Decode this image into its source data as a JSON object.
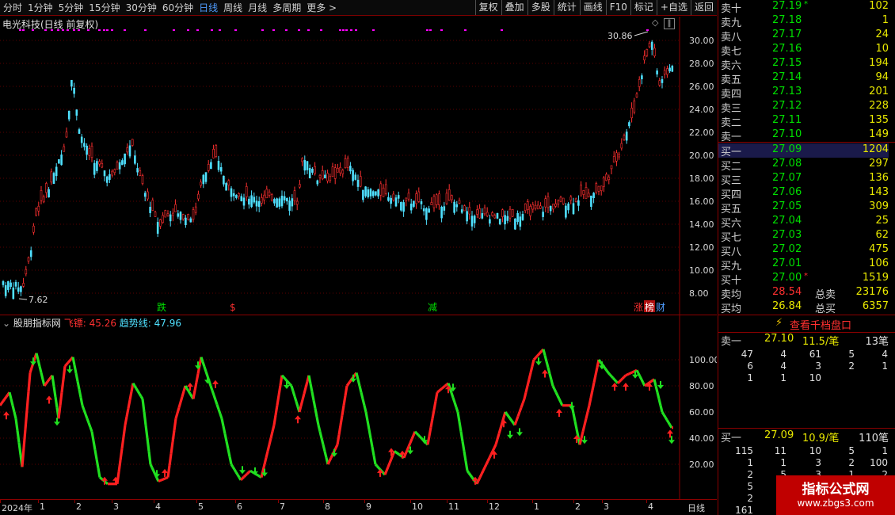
{
  "toolbar": {
    "periods": [
      "分时",
      "1分钟",
      "5分钟",
      "15分钟",
      "30分钟",
      "60分钟",
      "日线",
      "周线",
      "月线",
      "多周期",
      "更多 >"
    ],
    "active_period": "日线",
    "tools": [
      "复权",
      "叠加",
      "多股",
      "统计",
      "画线",
      "F10",
      "标记",
      "+自选",
      "返回"
    ]
  },
  "main_chart": {
    "title": "电光科技(日线 前复权)",
    "price_ticks": [
      "30.00",
      "28.00",
      "26.00",
      "24.00",
      "22.00",
      "20.00",
      "18.00",
      "16.00",
      "14.00",
      "12.00",
      "10.00",
      "8.00"
    ],
    "high_label": "30.86",
    "low_label": "7.62",
    "markers": [
      {
        "text": "跌",
        "color": "#00e000"
      },
      {
        "text": "$",
        "color": "#ff3030"
      },
      {
        "text": "减",
        "color": "#00e000"
      },
      {
        "text": "涨",
        "color": "#ff3030"
      },
      {
        "text": "榜",
        "color": "#ffffff"
      },
      {
        "text": "财",
        "color": "#4f9dff"
      }
    ]
  },
  "indicator": {
    "name": "股朋指标网",
    "line1_label": "飞镖:",
    "line1_value": "45.26",
    "line2_label": "趋势线:",
    "line2_value": "47.96",
    "ticks": [
      "100.00",
      "80.00",
      "60.00",
      "40.00",
      "20.00"
    ]
  },
  "xaxis": {
    "labels": [
      "2024年",
      "1",
      "2",
      "3",
      "4",
      "5",
      "6",
      "7",
      "8",
      "9",
      "10",
      "11",
      "12",
      "1",
      "2",
      "3",
      "4"
    ],
    "period_label": "日线"
  },
  "book": {
    "sell": [
      {
        "label": "卖十",
        "price": "27.19",
        "vol": "102"
      },
      {
        "label": "卖九",
        "price": "27.18",
        "vol": "1"
      },
      {
        "label": "卖八",
        "price": "27.17",
        "vol": "24"
      },
      {
        "label": "卖七",
        "price": "27.16",
        "vol": "10"
      },
      {
        "label": "卖六",
        "price": "27.15",
        "vol": "194"
      },
      {
        "label": "卖五",
        "price": "27.14",
        "vol": "94"
      },
      {
        "label": "卖四",
        "price": "27.13",
        "vol": "201"
      },
      {
        "label": "卖三",
        "price": "27.12",
        "vol": "228"
      },
      {
        "label": "卖二",
        "price": "27.11",
        "vol": "135"
      },
      {
        "label": "卖一",
        "price": "27.10",
        "vol": "149"
      }
    ],
    "buy": [
      {
        "label": "买一",
        "price": "27.09",
        "vol": "1204"
      },
      {
        "label": "买二",
        "price": "27.08",
        "vol": "297"
      },
      {
        "label": "买三",
        "price": "27.07",
        "vol": "136"
      },
      {
        "label": "买四",
        "price": "27.06",
        "vol": "143"
      },
      {
        "label": "买五",
        "price": "27.05",
        "vol": "309"
      },
      {
        "label": "买六",
        "price": "27.04",
        "vol": "25"
      },
      {
        "label": "买七",
        "price": "27.03",
        "vol": "62"
      },
      {
        "label": "买八",
        "price": "27.02",
        "vol": "475"
      },
      {
        "label": "买九",
        "price": "27.01",
        "vol": "106"
      },
      {
        "label": "买十",
        "price": "27.00",
        "vol": "1519"
      }
    ],
    "avg_sell_label": "卖均",
    "avg_sell_price": "28.54",
    "total_sell_label": "总卖",
    "total_sell": "23176",
    "avg_buy_label": "买均",
    "avg_buy_price": "26.84",
    "total_buy_label": "总买",
    "total_buy": "6357",
    "view_depth": "查看千档盘口",
    "sell1_label": "卖一",
    "sell1_price": "27.10",
    "sell1_per": "11.5/笔",
    "sell1_count": "13笔",
    "sell_detail": [
      [
        "47",
        "4",
        "61",
        "5",
        "4"
      ],
      [
        "6",
        "4",
        "3",
        "2",
        "1"
      ],
      [
        "1",
        "1",
        "10",
        "",
        ""
      ]
    ],
    "buy1_label": "买一",
    "buy1_price": "27.09",
    "buy1_per": "10.9/笔",
    "buy1_count": "110笔",
    "buy_detail": [
      [
        "115",
        "11",
        "10",
        "5",
        "1"
      ],
      [
        "1",
        "1",
        "3",
        "2",
        "100"
      ],
      [
        "2",
        "5",
        "3",
        "1",
        "2"
      ],
      [
        "5",
        "",
        "",
        "",
        ""
      ],
      [
        "2",
        "",
        "",
        "",
        ""
      ],
      [
        "161",
        "",
        "",
        "",
        ""
      ]
    ]
  },
  "watermark": {
    "line1": "指标公式网",
    "line2": "www.zbgs3.com"
  }
}
